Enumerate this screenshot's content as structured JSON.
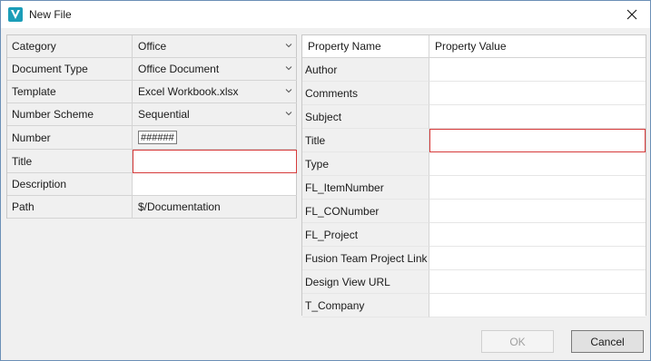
{
  "window": {
    "title": "New File"
  },
  "left_grid": {
    "rows": [
      {
        "label": "Category",
        "value": "Office",
        "type": "dropdown"
      },
      {
        "label": "Document Type",
        "value": "Office Document",
        "type": "dropdown"
      },
      {
        "label": "Template",
        "value": "Excel Workbook.xlsx",
        "type": "dropdown"
      },
      {
        "label": "Number Scheme",
        "value": "Sequential",
        "type": "dropdown"
      },
      {
        "label": "Number",
        "value": "######",
        "type": "mask"
      },
      {
        "label": "Title",
        "value": "",
        "type": "input-error"
      },
      {
        "label": "Description",
        "value": "",
        "type": "input"
      },
      {
        "label": "Path",
        "value": "$/Documentation",
        "type": "readonly"
      }
    ]
  },
  "right_grid": {
    "headers": {
      "name": "Property Name",
      "value": "Property Value"
    },
    "rows": [
      {
        "name": "Author",
        "value": ""
      },
      {
        "name": "Comments",
        "value": ""
      },
      {
        "name": "Subject",
        "value": ""
      },
      {
        "name": "Title",
        "value": "",
        "error": true
      },
      {
        "name": "Type",
        "value": ""
      },
      {
        "name": "FL_ItemNumber",
        "value": ""
      },
      {
        "name": "FL_CONumber",
        "value": ""
      },
      {
        "name": "FL_Project",
        "value": ""
      },
      {
        "name": "Fusion Team Project Link",
        "value": ""
      },
      {
        "name": "Design View URL",
        "value": ""
      },
      {
        "name": "T_Company",
        "value": ""
      }
    ]
  },
  "buttons": {
    "ok": "OK",
    "cancel": "Cancel"
  },
  "colors": {
    "error_border": "#d63a3a",
    "app_icon": "#1b9db8"
  },
  "icons": {
    "app": "vault-logo-icon",
    "close": "close-icon",
    "dropdown": "chevron-down-icon"
  }
}
